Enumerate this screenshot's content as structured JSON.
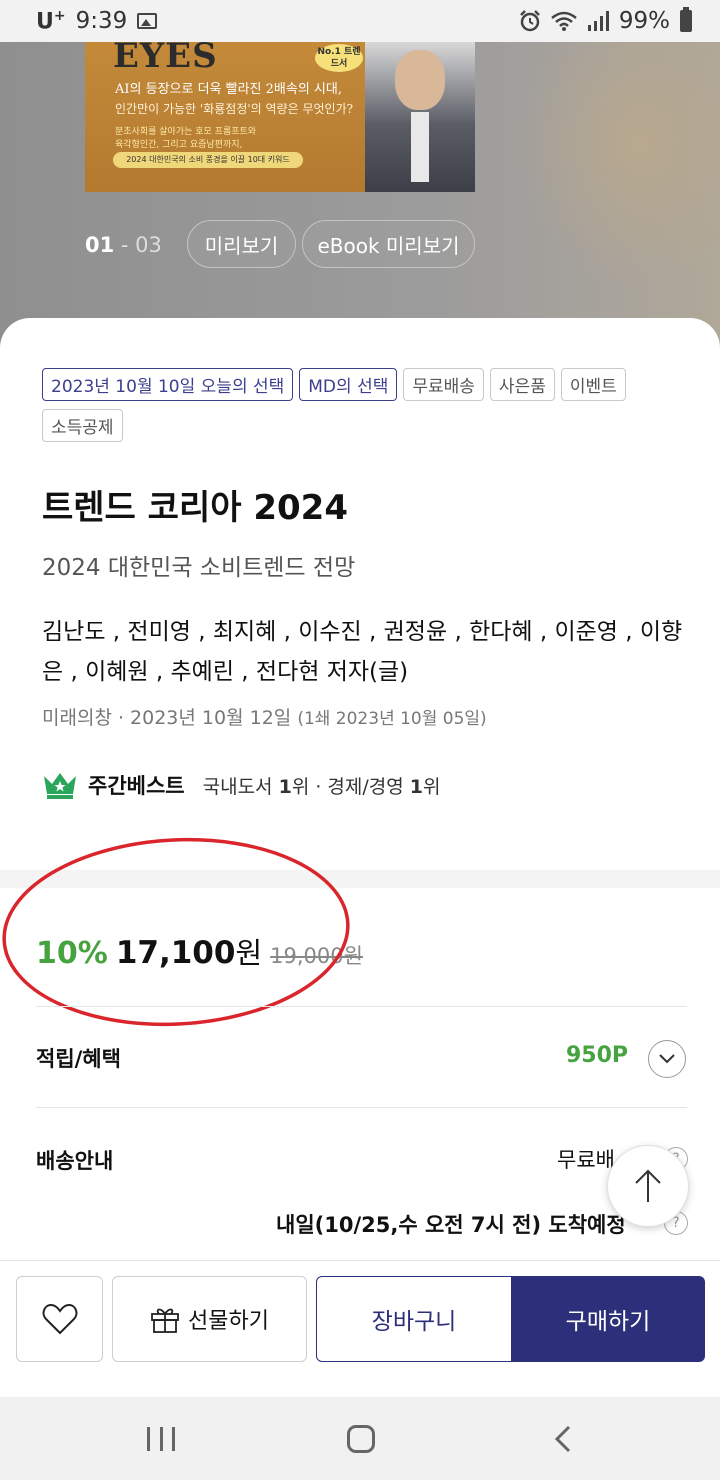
{
  "status_bar": {
    "carrier": "U",
    "carrier_sup": "+",
    "time": "9:39",
    "battery": "99%"
  },
  "hero": {
    "cover_title": "EYES",
    "cover_badge": "No.1 트렌드서",
    "cover_line1": "AI의 등장으로 더욱 빨라진 2배속의 시대,",
    "cover_line2": "인간만이 가능한 '화룡점정'의 역량은 무엇인가?",
    "cover_line3": "분초사회를 살아가는 호모 프롬프트와",
    "cover_line4": "육각형인간, 그리고 요즘남편까지,",
    "cover_pill": "2024 대한민국의 소비 풍경을 이끌 10대 키워드",
    "pager_current": "01",
    "pager_total": " - 03",
    "preview_label": "미리보기",
    "ebook_preview_label": "eBook 미리보기"
  },
  "tags": [
    {
      "label": "2023년 10월 10일 오늘의 선택",
      "primary": true
    },
    {
      "label": "MD의 선택",
      "primary": true
    },
    {
      "label": "무료배송",
      "primary": false
    },
    {
      "label": "사은품",
      "primary": false
    },
    {
      "label": "이벤트",
      "primary": false
    },
    {
      "label": "소득공제",
      "primary": false
    }
  ],
  "book": {
    "title": "트렌드 코리아 2024",
    "subtitle": "2024 대한민국 소비트렌드 전망",
    "authors": "김난도 , 전미영 , 최지혜 , 이수진 , 권정윤 , 한다혜 , 이준영 , 이향은 , 이혜원 , 추예린 , 전다현 저자(글)",
    "publisher_date": "미래의창 · 2023년 10월 12일",
    "first_print": "(1쇄 2023년 10월 05일)"
  },
  "bestseller": {
    "label": "주간베스트",
    "rank_domestic_label": "국내도서",
    "rank_domestic": "1",
    "rank_domestic_suffix": "위 · 경제/경영",
    "rank_category": "1",
    "rank_category_suffix": "위"
  },
  "price": {
    "discount": "10%",
    "sale": "17,100",
    "unit": "원",
    "original": "19,000원"
  },
  "benefits": {
    "label": "적립/혜택",
    "points": "950P"
  },
  "shipping": {
    "label": "배송안내",
    "value": "무료배",
    "help": "?",
    "arrival": "내일(10/25,수 오전 7시 전) 도착예정"
  },
  "actions": {
    "gift_label": "선물하기",
    "cart_label": "장바구니",
    "buy_label": "구매하기"
  },
  "colors": {
    "accent": "#2c2f7a",
    "discount": "#47a340",
    "annotation": "#d9252b"
  }
}
